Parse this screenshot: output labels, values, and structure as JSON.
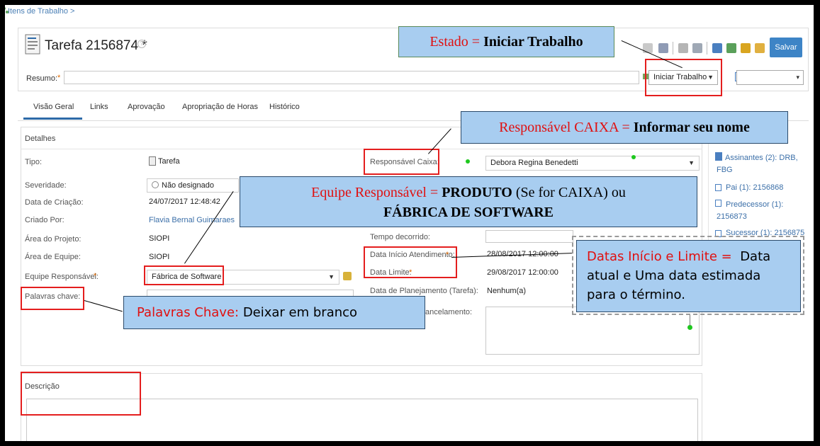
{
  "breadcrumb": "Itens de Trabalho >",
  "task": {
    "title": "Tarefa 2156874 *",
    "help": "?"
  },
  "toolbar": {
    "save": "Salvar"
  },
  "summary": {
    "label": "Resumo:",
    "required": "*",
    "state": "Iniciar Trabalho"
  },
  "tabs": [
    "Visão Geral",
    "Links",
    "Aprovação",
    "Apropriação de Horas",
    "Histórico"
  ],
  "details": {
    "heading": "Detalhes",
    "tipo_label": "Tipo:",
    "tipo_value": "Tarefa",
    "severidade_label": "Severidade:",
    "severidade_value": "Não designado",
    "data_criacao_label": "Data de Criação:",
    "data_criacao_value": "24/07/2017 12:48:42",
    "criado_label": "Criado Por:",
    "criado_value": "Flavia Bernal Guimaraes",
    "area_projeto_label": "Área do Projeto:",
    "area_projeto_value": "SIOPI",
    "area_equipe_label": "Área de Equipe:",
    "area_equipe_value": "SIOPI",
    "equipe_label": "Equipe Responsável:",
    "equipe_value": "Fábrica de Software",
    "palavras_label": "Palavras chave:",
    "responsavel_label": "Responsável Caixa:",
    "responsavel_value": "Debora Regina Benedetti",
    "tempo_label": "Tempo decorrido:",
    "inicio_label": "Data Início Atendimento:",
    "inicio_value": "28/08/2017 12:00:00",
    "limite_label": "Data Limite:",
    "limite_value": "29/08/2017 12:00:00",
    "planejamento_label": "Data de Planejamento (Tarefa):",
    "planejamento_value": "Nenhum(a)",
    "cancelamento_label": "ancelamento:"
  },
  "links_panel": {
    "assinantes": "Assinantes (2): DRB, FBG",
    "pai": "Pai (1): 2156868",
    "predecessor": "Predecessor (1): 2156873",
    "sucessor": "Sucessor (1): 2156875"
  },
  "descricao": {
    "heading": "Descrição"
  },
  "callouts": {
    "estado_red": "Estado = ",
    "estado_bold": "Iniciar Trabalho",
    "resp_red": "Responsável CAIXA = ",
    "resp_bold": "Informar seu nome",
    "equipe_red": "Equipe Responsável = ",
    "equipe_bold1": "PRODUTO",
    "equipe_normal": " (Se for CAIXA) ou",
    "equipe_bold2": "FÁBRICA DE SOFTWARE",
    "palavras_red": "Palavras Chave:",
    "palavras_normal": " Deixar em branco",
    "datas_red": "Datas Início e Limite =",
    "datas_normal1": "Data",
    "datas_normal2": "atual e Uma data estimada",
    "datas_normal3": "para o término."
  },
  "colors": {
    "accent": "#3d84c6",
    "annotation_red": "#e41e1e",
    "callout_bg": "#a8cdf0"
  }
}
